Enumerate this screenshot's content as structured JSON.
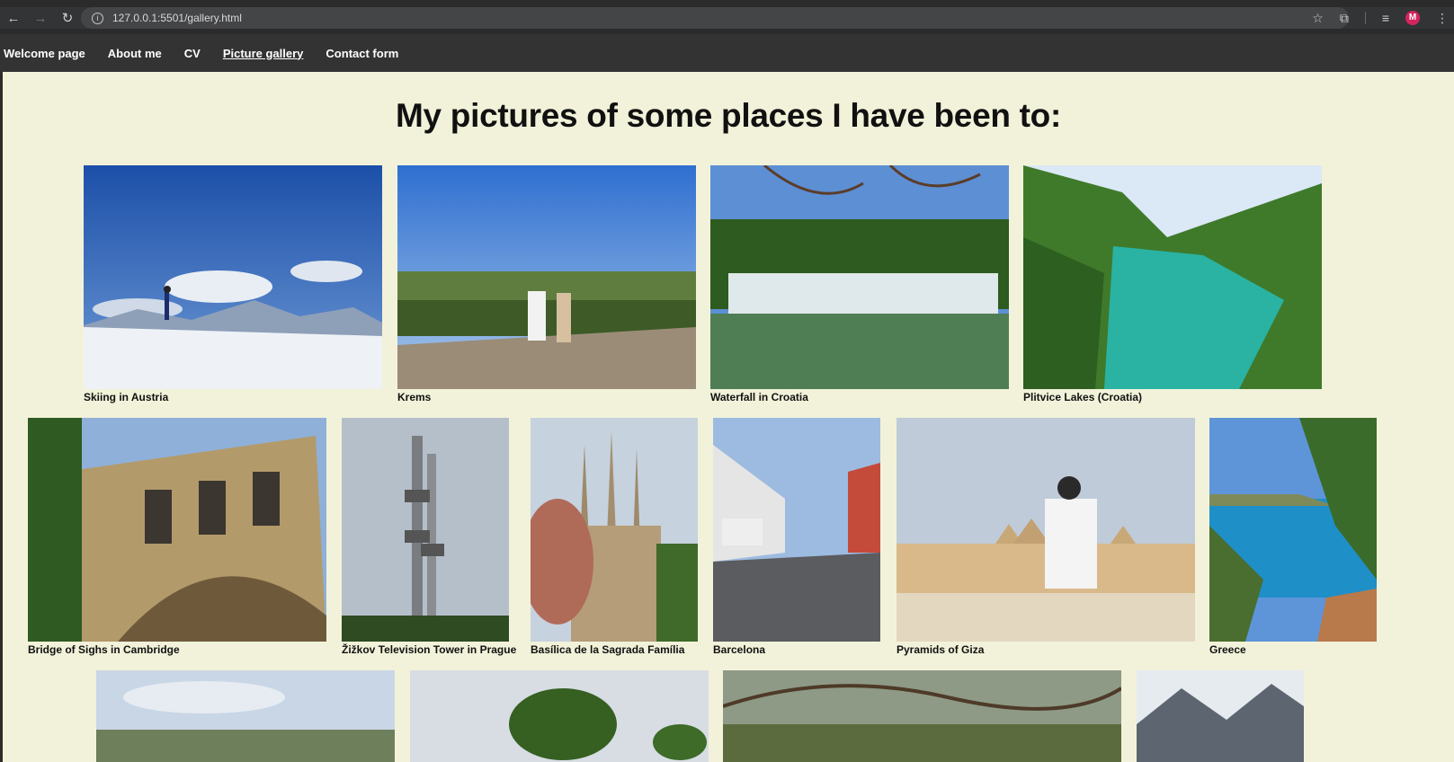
{
  "browser": {
    "url": "127.0.0.1:5501/gallery.html",
    "avatar_letter": "M",
    "icons": [
      "back-arrow-icon",
      "forward-arrow-icon",
      "reload-icon",
      "info-icon",
      "star-icon",
      "extensions-icon",
      "reading-list-icon",
      "menu-icon"
    ]
  },
  "nav": {
    "items": [
      "Welcome page",
      "About me",
      "CV",
      "Picture gallery",
      "Contact form"
    ],
    "active": "Picture gallery"
  },
  "title": "My pictures of some places I have been to:",
  "gallery": {
    "row1": [
      "Skiing in Austria",
      "Krems",
      "Waterfall in Croatia",
      "Plitvice Lakes (Croatia)"
    ],
    "row2": [
      "Bridge of Sighs in Cambridge",
      "Žižkov Television Tower in Prague",
      "Basílica de la Sagrada Família",
      "Barcelona",
      "Pyramids of Giza",
      "Greece"
    ]
  },
  "colors": {
    "page_bg": "#f2f2da",
    "nav_bg": "#333333",
    "chrome_bg": "#2b2b2b",
    "avatar": "#d3245e"
  }
}
